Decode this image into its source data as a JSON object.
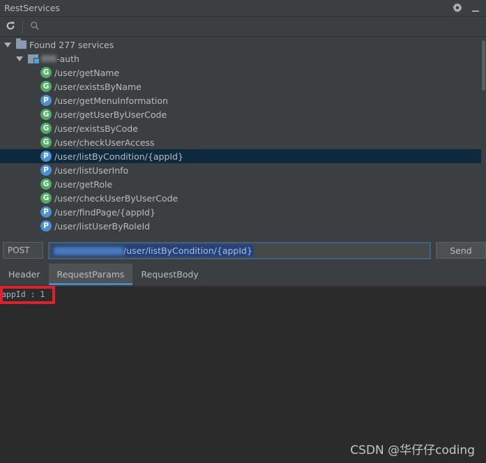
{
  "window": {
    "title": "RestServices"
  },
  "icons": {
    "gear": "gear-icon",
    "minimize": "minimize-icon",
    "refresh": "refresh-icon",
    "search": "search-icon"
  },
  "tree": {
    "root_label": "Found 277 services",
    "module_label_suffix": "-auth",
    "items": [
      {
        "method_letter": "G",
        "path": "/user/getName"
      },
      {
        "method_letter": "G",
        "path": "/user/existsByName"
      },
      {
        "method_letter": "P",
        "path": "/user/getMenuInformation"
      },
      {
        "method_letter": "G",
        "path": "/user/getUserByUserCode"
      },
      {
        "method_letter": "G",
        "path": "/user/existsByCode"
      },
      {
        "method_letter": "G",
        "path": "/user/checkUserAccess"
      },
      {
        "method_letter": "P",
        "path": "/user/listByCondition/{appId}",
        "selected": true
      },
      {
        "method_letter": "P",
        "path": "/user/listUserInfo"
      },
      {
        "method_letter": "G",
        "path": "/user/getRole"
      },
      {
        "method_letter": "G",
        "path": "/user/checkUserByUserCode"
      },
      {
        "method_letter": "P",
        "path": "/user/findPage/{appId}"
      },
      {
        "method_letter": "P",
        "path": "/user/listUserByRoleId"
      }
    ]
  },
  "request": {
    "method": "POST",
    "url_path": "/user/listByCondition/{appId}",
    "send_label": "Send"
  },
  "tabs": [
    {
      "label": "Header"
    },
    {
      "label": "RequestParams",
      "active": true
    },
    {
      "label": "RequestBody"
    }
  ],
  "params": {
    "text": "appId : 1"
  },
  "watermark": "CSDN @华仔仔coding"
}
